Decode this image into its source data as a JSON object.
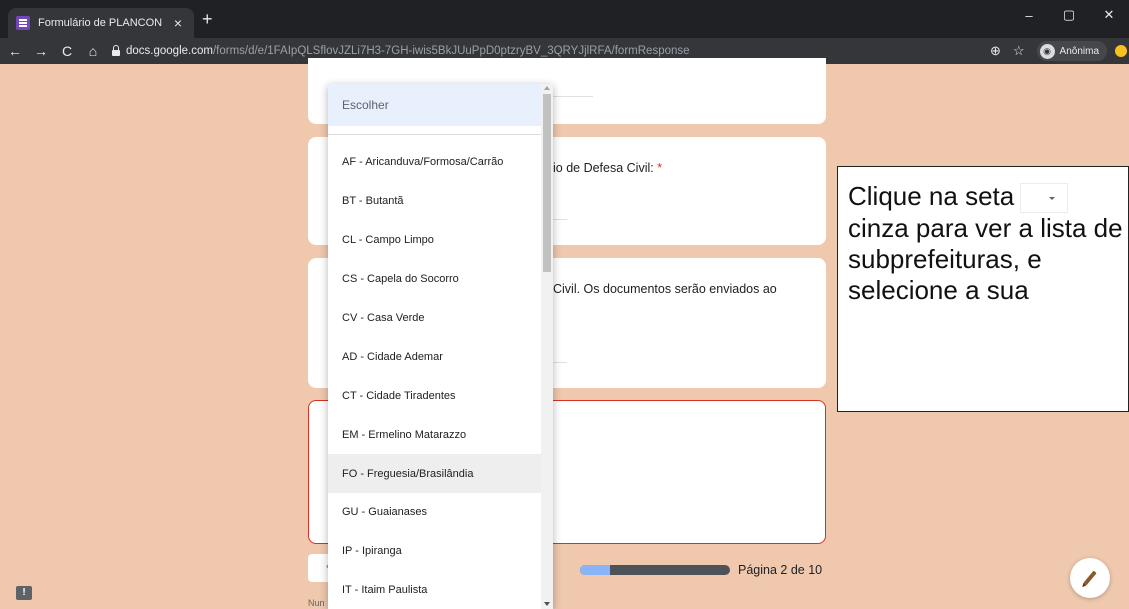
{
  "browser": {
    "tab_title": "Formulário de PLANCON",
    "tab_close": "×",
    "new_tab": "+",
    "url_host": "docs.google.com",
    "url_path": "/forms/d/e/1FAIpQLSflovJZLi7H3-7GH-iwis5BkJUuPpD0ptzryBV_3QRYJjlRFA/formResponse",
    "profile_label": "Anônima",
    "win_min": "–",
    "win_max": "▢",
    "win_close": "✕",
    "nav_back": "←",
    "nav_forward": "→",
    "nav_reload": "C",
    "nav_home": "⌂",
    "zoom_icon": "⊕",
    "star_icon": "☆"
  },
  "form": {
    "question2_partial": "io de Defesa Civil: ",
    "required_mark": "*",
    "question3_partial": "Civil. Os documentos serão enviados ao",
    "footer_partial": "Nun",
    "progress_fraction": 0.2,
    "page_label": "Página 2 de 10",
    "back_icon": "‹",
    "feedback_icon": "!"
  },
  "dropdown": {
    "placeholder": "Escolher",
    "highlighted_index": 8,
    "options": [
      "AF - Aricanduva/Formosa/Carrão",
      "BT - Butantã",
      "CL - Campo Limpo",
      "CS - Capela do Socorro",
      "CV - Casa Verde",
      "AD - Cidade Ademar",
      "CT - Cidade Tiradentes",
      "EM - Ermelino Matarazzo",
      "FO - Freguesia/Brasilândia",
      "GU - Guaianases",
      "IP - Ipiranga",
      "IT - Itaim Paulista"
    ]
  },
  "callout": {
    "line1": "Clique na seta",
    "rest": "cinza para ver a lista de subprefeituras, e selecione a sua"
  },
  "colors": {
    "background": "#efc8ae",
    "accent": "#7248b9",
    "error": "#d93025"
  }
}
